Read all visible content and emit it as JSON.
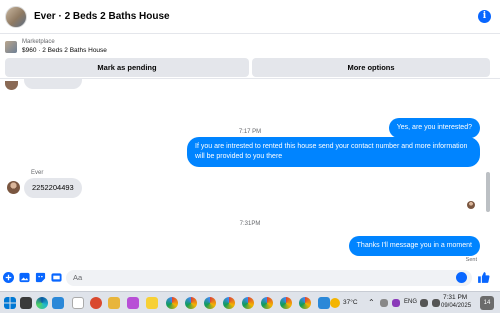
{
  "header": {
    "title": "Ever · 2 Beds 2 Baths House",
    "info_icon": "info-icon"
  },
  "marketplace": {
    "label": "Marketplace",
    "listing": "$960 · 2 Beds 2 Baths House",
    "buttons": {
      "pending": "Mark as pending",
      "more": "More options"
    }
  },
  "messages": {
    "time1": "7:17 PM",
    "out1": "Yes, are you interested?",
    "out2": "If you are intrested to rented this house send your contact number and more information will be provided to you there",
    "sender": "Ever",
    "in1": "2252204493",
    "time2": "7:31PM",
    "out3": "Thanks I'll message you in a moment",
    "status": "Sent"
  },
  "composer": {
    "placeholder": "Aa"
  },
  "taskbar": {
    "weather": "37°C",
    "language": "ENG",
    "time": "7:31 PM",
    "date": "09/04/2025",
    "notification_count": "14"
  },
  "colors": {
    "accent": "#0084ff",
    "brand": "#0866ff",
    "bubble_in": "#e4e6eb"
  }
}
